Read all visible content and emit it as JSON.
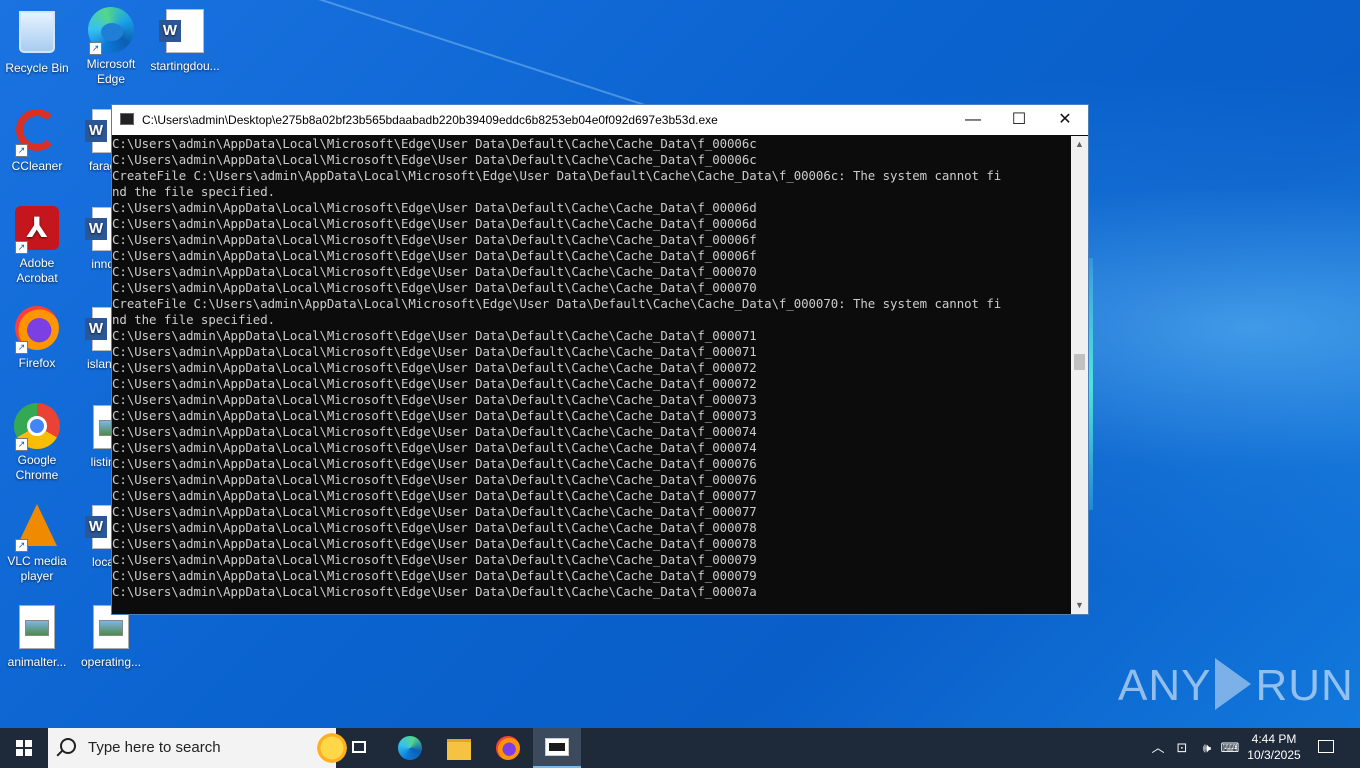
{
  "desktop": {
    "icons": [
      {
        "label": "Recycle Bin",
        "icon": "recycle-bin-icon"
      },
      {
        "label": "Microsoft Edge",
        "icon": "edge-icon"
      },
      {
        "label": "startingdou...",
        "icon": "word-doc-icon"
      },
      {
        "label": "CCleaner",
        "icon": "ccleaner-icon"
      },
      {
        "label": "farage...",
        "icon": "word-doc-icon"
      },
      {
        "label": "Adobe Acrobat",
        "icon": "acrobat-icon"
      },
      {
        "label": "innqu...",
        "icon": "word-doc-icon"
      },
      {
        "label": "Firefox",
        "icon": "firefox-icon"
      },
      {
        "label": "islandp...",
        "icon": "word-doc-icon"
      },
      {
        "label": "Google Chrome",
        "icon": "chrome-icon"
      },
      {
        "label": "listing...",
        "icon": "image-file-icon"
      },
      {
        "label": "VLC media player",
        "icon": "vlc-icon"
      },
      {
        "label": "locati...",
        "icon": "word-doc-icon"
      },
      {
        "label": "animalter...",
        "icon": "image-file-icon"
      },
      {
        "label": "operating...",
        "icon": "image-file-icon"
      }
    ]
  },
  "window": {
    "title": "C:\\Users\\admin\\Desktop\\e275b8a02bf23b565bdaabadb220b39409eddc6b8253eb04e0f092d697e3b53d.exe",
    "minimize": "—",
    "maximize": "☐",
    "close": "✕",
    "console_lines": [
      "C:\\Users\\admin\\AppData\\Local\\Microsoft\\Edge\\User Data\\Default\\Cache\\Cache_Data\\f_00006c",
      "C:\\Users\\admin\\AppData\\Local\\Microsoft\\Edge\\User Data\\Default\\Cache\\Cache_Data\\f_00006c",
      "CreateFile C:\\Users\\admin\\AppData\\Local\\Microsoft\\Edge\\User Data\\Default\\Cache\\Cache_Data\\f_00006c: The system cannot fi",
      "nd the file specified.",
      "C:\\Users\\admin\\AppData\\Local\\Microsoft\\Edge\\User Data\\Default\\Cache\\Cache_Data\\f_00006d",
      "C:\\Users\\admin\\AppData\\Local\\Microsoft\\Edge\\User Data\\Default\\Cache\\Cache_Data\\f_00006d",
      "C:\\Users\\admin\\AppData\\Local\\Microsoft\\Edge\\User Data\\Default\\Cache\\Cache_Data\\f_00006f",
      "C:\\Users\\admin\\AppData\\Local\\Microsoft\\Edge\\User Data\\Default\\Cache\\Cache_Data\\f_00006f",
      "C:\\Users\\admin\\AppData\\Local\\Microsoft\\Edge\\User Data\\Default\\Cache\\Cache_Data\\f_000070",
      "C:\\Users\\admin\\AppData\\Local\\Microsoft\\Edge\\User Data\\Default\\Cache\\Cache_Data\\f_000070",
      "CreateFile C:\\Users\\admin\\AppData\\Local\\Microsoft\\Edge\\User Data\\Default\\Cache\\Cache_Data\\f_000070: The system cannot fi",
      "nd the file specified.",
      "C:\\Users\\admin\\AppData\\Local\\Microsoft\\Edge\\User Data\\Default\\Cache\\Cache_Data\\f_000071",
      "C:\\Users\\admin\\AppData\\Local\\Microsoft\\Edge\\User Data\\Default\\Cache\\Cache_Data\\f_000071",
      "C:\\Users\\admin\\AppData\\Local\\Microsoft\\Edge\\User Data\\Default\\Cache\\Cache_Data\\f_000072",
      "C:\\Users\\admin\\AppData\\Local\\Microsoft\\Edge\\User Data\\Default\\Cache\\Cache_Data\\f_000072",
      "C:\\Users\\admin\\AppData\\Local\\Microsoft\\Edge\\User Data\\Default\\Cache\\Cache_Data\\f_000073",
      "C:\\Users\\admin\\AppData\\Local\\Microsoft\\Edge\\User Data\\Default\\Cache\\Cache_Data\\f_000073",
      "C:\\Users\\admin\\AppData\\Local\\Microsoft\\Edge\\User Data\\Default\\Cache\\Cache_Data\\f_000074",
      "C:\\Users\\admin\\AppData\\Local\\Microsoft\\Edge\\User Data\\Default\\Cache\\Cache_Data\\f_000074",
      "C:\\Users\\admin\\AppData\\Local\\Microsoft\\Edge\\User Data\\Default\\Cache\\Cache_Data\\f_000076",
      "C:\\Users\\admin\\AppData\\Local\\Microsoft\\Edge\\User Data\\Default\\Cache\\Cache_Data\\f_000076",
      "C:\\Users\\admin\\AppData\\Local\\Microsoft\\Edge\\User Data\\Default\\Cache\\Cache_Data\\f_000077",
      "C:\\Users\\admin\\AppData\\Local\\Microsoft\\Edge\\User Data\\Default\\Cache\\Cache_Data\\f_000077",
      "C:\\Users\\admin\\AppData\\Local\\Microsoft\\Edge\\User Data\\Default\\Cache\\Cache_Data\\f_000078",
      "C:\\Users\\admin\\AppData\\Local\\Microsoft\\Edge\\User Data\\Default\\Cache\\Cache_Data\\f_000078",
      "C:\\Users\\admin\\AppData\\Local\\Microsoft\\Edge\\User Data\\Default\\Cache\\Cache_Data\\f_000079",
      "C:\\Users\\admin\\AppData\\Local\\Microsoft\\Edge\\User Data\\Default\\Cache\\Cache_Data\\f_000079",
      "C:\\Users\\admin\\AppData\\Local\\Microsoft\\Edge\\User Data\\Default\\Cache\\Cache_Data\\f_00007a"
    ],
    "scroll_up": "▲",
    "scroll_down": "▼"
  },
  "watermark": {
    "left": "ANY",
    "right": "RUN"
  },
  "taskbar": {
    "search_placeholder": "Type here to search",
    "apps": [
      "task-view-icon",
      "edge-icon",
      "file-explorer-icon",
      "firefox-icon",
      "console-app-icon"
    ],
    "tray": {
      "chevron": "︿",
      "network": "⊡",
      "volume": "🕪",
      "ime": "⌨"
    },
    "time": "4:44 PM",
    "date": "10/3/2025"
  },
  "colors": {
    "console_bg": "#0c0c0c",
    "console_fg": "#cccccc",
    "taskbar": "#1e2a3a",
    "desktop": "#0a6fd6"
  }
}
